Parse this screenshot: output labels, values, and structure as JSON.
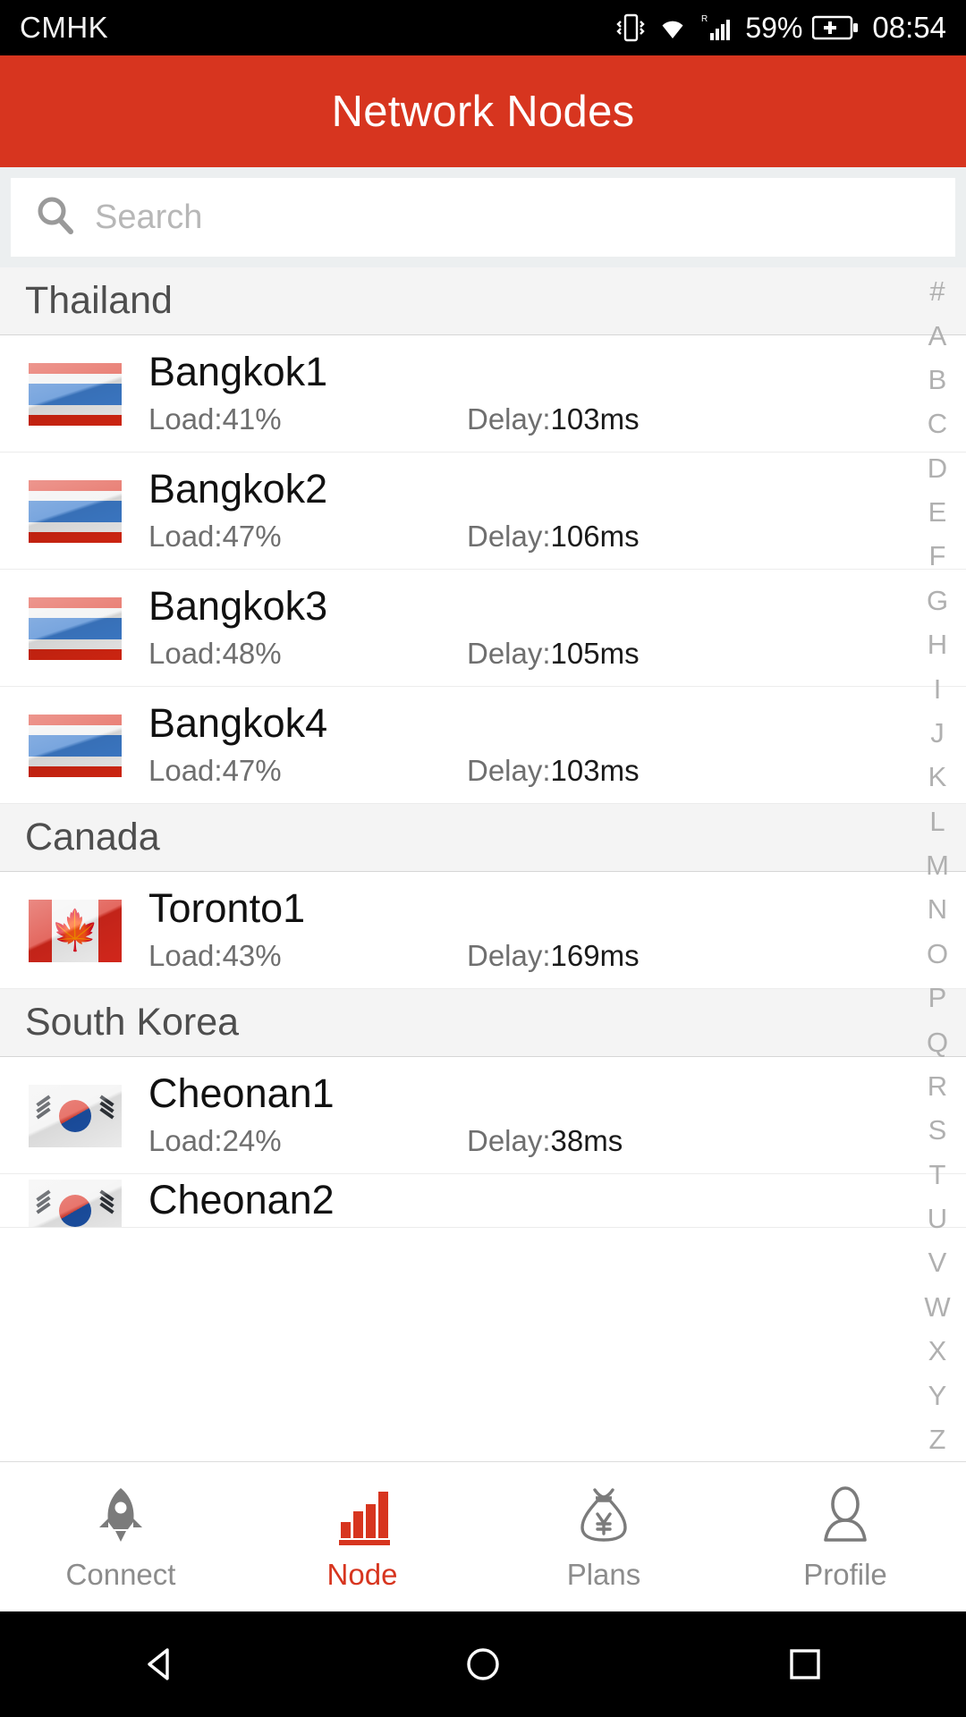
{
  "status_bar": {
    "carrier": "CMHK",
    "battery_percent": "59%",
    "clock": "08:54",
    "icons": [
      "vibrate-icon",
      "wifi-icon",
      "signal-roaming-icon",
      "battery-charging-icon"
    ]
  },
  "header": {
    "title": "Network Nodes"
  },
  "search": {
    "placeholder": "Search",
    "value": ""
  },
  "colors": {
    "accent": "#d7351f",
    "header_bg": "#d7351f",
    "section_bg": "#f4f4f4",
    "tab_inactive": "#8c8c8c"
  },
  "list": {
    "sections": [
      {
        "country": "Thailand",
        "flag": "flag-th",
        "nodes": [
          {
            "name": "Bangkok1",
            "load_label": "Load:41%",
            "delay_label": "Delay:",
            "delay_value": "103ms"
          },
          {
            "name": "Bangkok2",
            "load_label": "Load:47%",
            "delay_label": "Delay:",
            "delay_value": "106ms"
          },
          {
            "name": "Bangkok3",
            "load_label": "Load:48%",
            "delay_label": "Delay:",
            "delay_value": "105ms"
          },
          {
            "name": "Bangkok4",
            "load_label": "Load:47%",
            "delay_label": "Delay:",
            "delay_value": "103ms"
          }
        ]
      },
      {
        "country": "Canada",
        "flag": "flag-ca",
        "nodes": [
          {
            "name": "Toronto1",
            "load_label": "Load:43%",
            "delay_label": "Delay:",
            "delay_value": "169ms"
          }
        ]
      },
      {
        "country": "South Korea",
        "flag": "flag-kr",
        "nodes": [
          {
            "name": "Cheonan1",
            "load_label": "Load:24%",
            "delay_label": "Delay:",
            "delay_value": "38ms"
          },
          {
            "name": "Cheonan2",
            "load_label": "",
            "delay_label": "",
            "delay_value": ""
          }
        ]
      }
    ]
  },
  "alpha_index": [
    "#",
    "A",
    "B",
    "C",
    "D",
    "E",
    "F",
    "G",
    "H",
    "I",
    "J",
    "K",
    "L",
    "M",
    "N",
    "O",
    "P",
    "Q",
    "R",
    "S",
    "T",
    "U",
    "V",
    "W",
    "X",
    "Y",
    "Z"
  ],
  "tabs": [
    {
      "label": "Connect",
      "icon": "rocket-icon",
      "active": false
    },
    {
      "label": "Node",
      "icon": "bar-chart-icon",
      "active": true
    },
    {
      "label": "Plans",
      "icon": "money-bag-yen-icon",
      "active": false
    },
    {
      "label": "Profile",
      "icon": "person-icon",
      "active": false
    }
  ],
  "nav_bar": {
    "back": "back-triangle-icon",
    "home": "home-circle-icon",
    "recents": "recents-square-icon"
  }
}
